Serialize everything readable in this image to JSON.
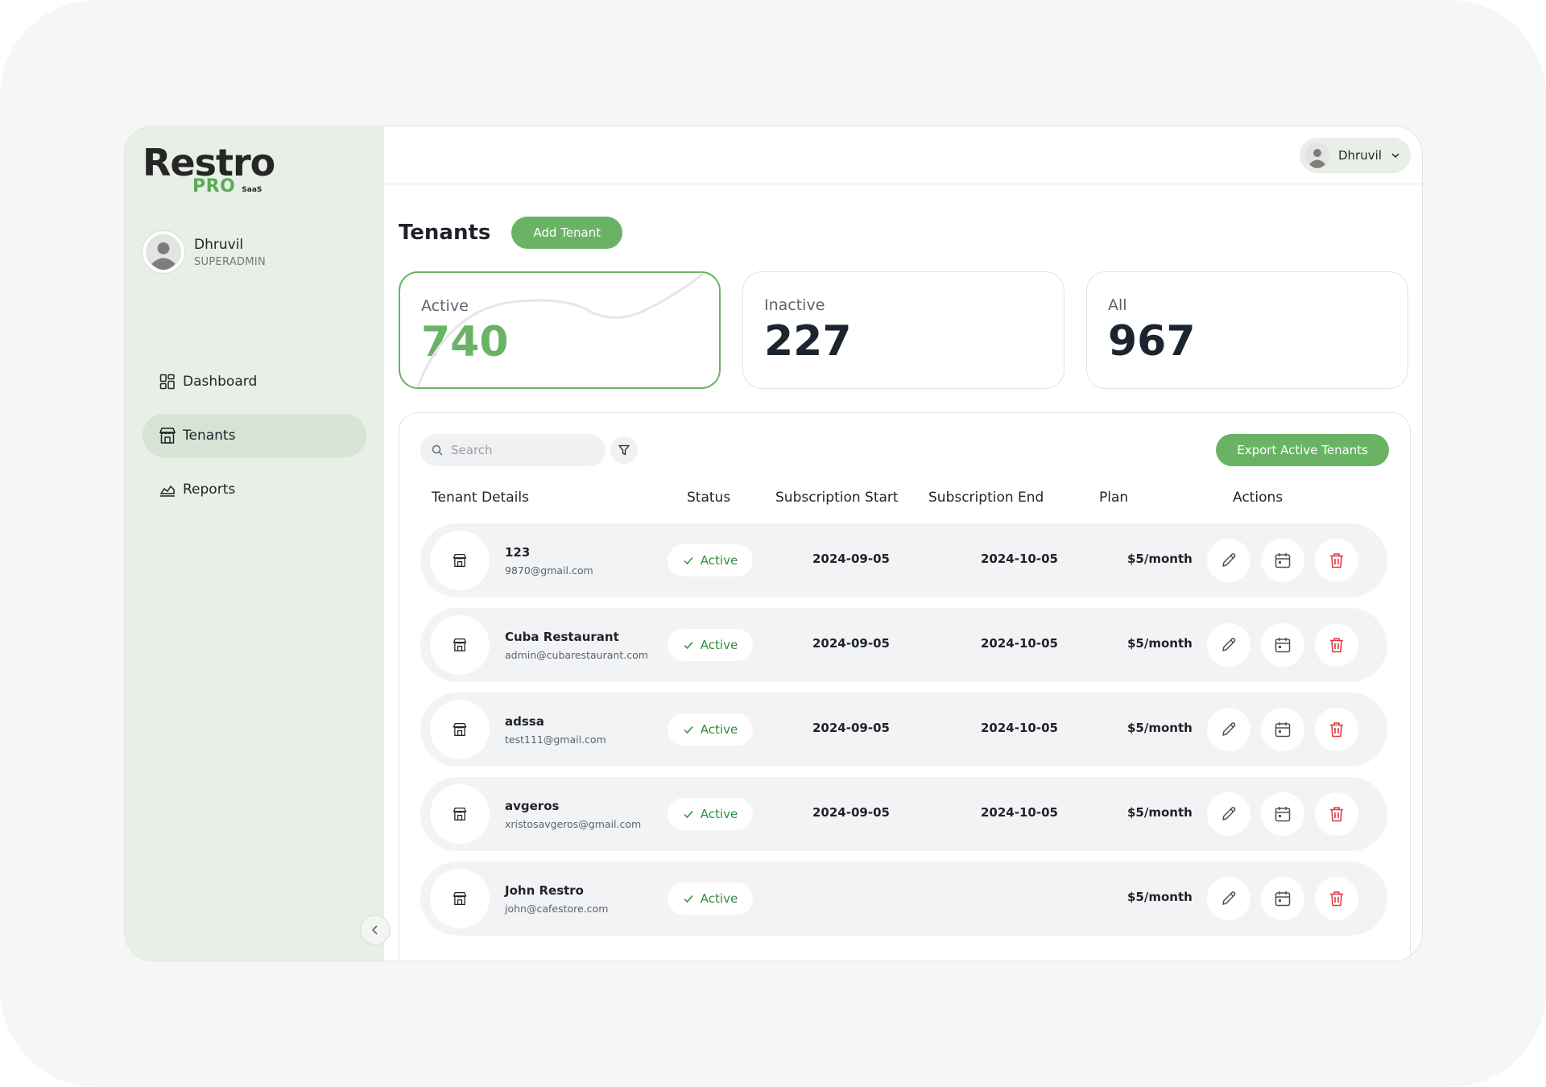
{
  "brand": {
    "name": "Restro",
    "sub": "PRO",
    "tag": "SaaS",
    "accent": "#6ab365"
  },
  "user": {
    "name": "Dhruvil",
    "role": "SUPERADMIN"
  },
  "nav": [
    {
      "label": "Dashboard",
      "icon": "dashboard-icon",
      "active": false
    },
    {
      "label": "Tenants",
      "icon": "store-icon",
      "active": true
    },
    {
      "label": "Reports",
      "icon": "chart-area-icon",
      "active": false
    }
  ],
  "topbar": {
    "user_name": "Dhruvil"
  },
  "page": {
    "title": "Tenants",
    "add_button": "Add Tenant"
  },
  "stats": [
    {
      "label": "Active",
      "value": "740"
    },
    {
      "label": "Inactive",
      "value": "227"
    },
    {
      "label": "All",
      "value": "967"
    }
  ],
  "toolbar": {
    "search_placeholder": "Search",
    "export_button": "Export Active Tenants"
  },
  "columns": [
    "Tenant Details",
    "Status",
    "Subscription Start",
    "Subscription End",
    "Plan",
    "Actions"
  ],
  "rows": [
    {
      "name": "123",
      "email": "9870@gmail.com",
      "status": "Active",
      "start": "2024-09-05",
      "end": "2024-10-05",
      "plan": "$5/month"
    },
    {
      "name": "Cuba Restaurant",
      "email": "admin@cubarestaurant.com",
      "status": "Active",
      "start": "2024-09-05",
      "end": "2024-10-05",
      "plan": "$5/month"
    },
    {
      "name": "adssa",
      "email": "test111@gmail.com",
      "status": "Active",
      "start": "2024-09-05",
      "end": "2024-10-05",
      "plan": "$5/month"
    },
    {
      "name": "avgeros",
      "email": "xristosavgeros@gmail.com",
      "status": "Active",
      "start": "2024-09-05",
      "end": "2024-10-05",
      "plan": "$5/month"
    },
    {
      "name": "John Restro",
      "email": "john@cafestore.com",
      "status": "Active",
      "start": "",
      "end": "",
      "plan": "$5/month"
    }
  ]
}
